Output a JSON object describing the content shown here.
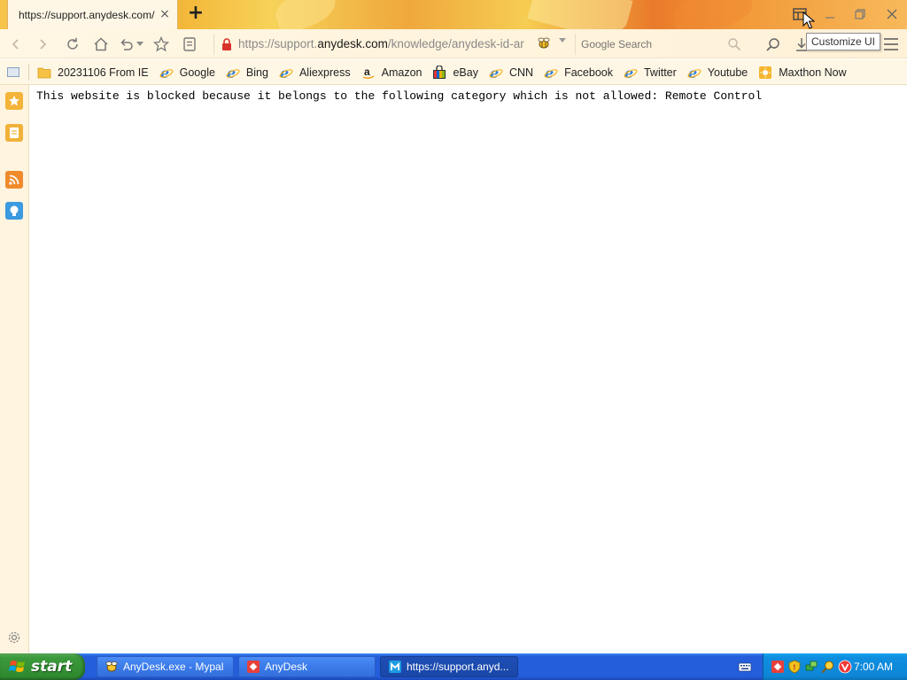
{
  "browser": {
    "tab": {
      "title": "https://support.anydesk.com/"
    },
    "window_buttons": {
      "customize_ui_tooltip": "Customize UI"
    },
    "address": {
      "prefix": "https://support.",
      "host": "anydesk.com",
      "path": "/knowledge/anydesk-id-ar"
    },
    "search": {
      "placeholder": "Google Search"
    }
  },
  "bookmarks": [
    {
      "label": "20231106 From IE",
      "icon": "folder-icon"
    },
    {
      "label": "Google",
      "icon": "ie-icon"
    },
    {
      "label": "Bing",
      "icon": "ie-icon"
    },
    {
      "label": "Aliexpress",
      "icon": "ie-icon"
    },
    {
      "label": "Amazon",
      "icon": "amazon-icon"
    },
    {
      "label": "eBay",
      "icon": "ebay-icon"
    },
    {
      "label": "CNN",
      "icon": "ie-icon"
    },
    {
      "label": "Facebook",
      "icon": "ie-icon"
    },
    {
      "label": "Twitter",
      "icon": "ie-icon"
    },
    {
      "label": "Youtube",
      "icon": "ie-icon"
    },
    {
      "label": "Maxthon Now",
      "icon": "maxthon-now-icon"
    }
  ],
  "page": {
    "message": "This website is blocked because it belongs to the following category which is not allowed: Remote Control"
  },
  "taskbar": {
    "start_label": "start",
    "tasks": [
      {
        "label": "AnyDesk.exe - Mypal",
        "icon": "mypal-icon"
      },
      {
        "label": "AnyDesk",
        "icon": "anydesk-icon"
      },
      {
        "label": "https://support.anyd...",
        "icon": "maxthon-icon"
      }
    ],
    "clock": "7:00 AM"
  },
  "colors": {
    "accent_orange": "#f4b43a",
    "taskbar_blue": "#245edb",
    "start_green": "#3c9a3c",
    "tray_blue": "#0e86d6",
    "anydesk_red": "#e8403a"
  }
}
